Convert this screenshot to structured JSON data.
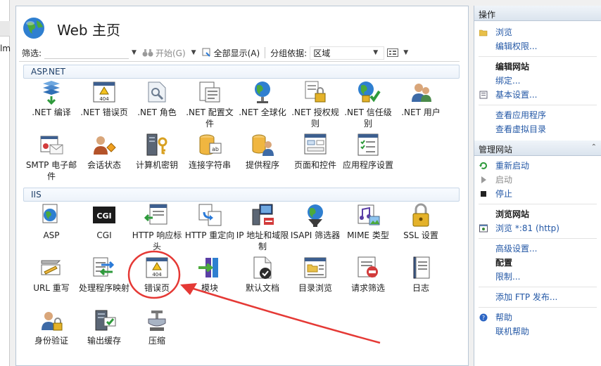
{
  "left_strip": {
    "fragment": "lm"
  },
  "header": {
    "title": "Web 主页"
  },
  "toolbar": {
    "filter_label": "筛选:",
    "filter_value": "",
    "start_label": "开始(G)",
    "show_all_label": "全部显示(A)",
    "group_label": "分组依据:",
    "group_value": "区域"
  },
  "sections": [
    {
      "title": "ASP.NET"
    },
    {
      "title": "IIS"
    }
  ],
  "aspnet_items": [
    {
      "label": ".NET 编译",
      "icon": "net-compile-icon"
    },
    {
      "label": ".NET 错误页",
      "icon": "net-error-page-icon"
    },
    {
      "label": ".NET 角色",
      "icon": "net-roles-icon"
    },
    {
      "label": ".NET 配置文件",
      "icon": "net-profile-icon"
    },
    {
      "label": ".NET 全球化",
      "icon": "net-globalization-icon"
    },
    {
      "label": ".NET 授权规则",
      "icon": "net-authorization-icon"
    },
    {
      "label": ".NET 信任级别",
      "icon": "net-trust-icon"
    },
    {
      "label": ".NET 用户",
      "icon": "net-users-icon"
    },
    {
      "label": "SMTP 电子邮件",
      "icon": "smtp-email-icon"
    },
    {
      "label": "会话状态",
      "icon": "session-state-icon"
    },
    {
      "label": "计算机密钥",
      "icon": "machine-key-icon"
    },
    {
      "label": "连接字符串",
      "icon": "connection-strings-icon"
    },
    {
      "label": "提供程序",
      "icon": "providers-icon"
    },
    {
      "label": "页面和控件",
      "icon": "pages-controls-icon"
    },
    {
      "label": "应用程序设置",
      "icon": "app-settings-icon"
    }
  ],
  "iis_items": [
    {
      "label": "ASP",
      "icon": "asp-icon"
    },
    {
      "label": "CGI",
      "icon": "cgi-icon"
    },
    {
      "label": "HTTP 响应标头",
      "icon": "http-headers-icon"
    },
    {
      "label": "HTTP 重定向",
      "icon": "http-redirect-icon"
    },
    {
      "label": "IP 地址和域限制",
      "icon": "ip-restrictions-icon"
    },
    {
      "label": "ISAPI 筛选器",
      "icon": "isapi-filters-icon"
    },
    {
      "label": "MIME 类型",
      "icon": "mime-types-icon"
    },
    {
      "label": "SSL 设置",
      "icon": "ssl-settings-icon"
    },
    {
      "label": "URL 重写",
      "icon": "url-rewrite-icon"
    },
    {
      "label": "处理程序映射",
      "icon": "handler-mappings-icon"
    },
    {
      "label": "错误页",
      "icon": "error-pages-icon"
    },
    {
      "label": "模块",
      "icon": "modules-icon"
    },
    {
      "label": "默认文档",
      "icon": "default-document-icon"
    },
    {
      "label": "目录浏览",
      "icon": "directory-browsing-icon"
    },
    {
      "label": "请求筛选",
      "icon": "request-filtering-icon"
    },
    {
      "label": "日志",
      "icon": "logging-icon"
    },
    {
      "label": "身份验证",
      "icon": "authentication-icon"
    },
    {
      "label": "输出缓存",
      "icon": "output-caching-icon"
    },
    {
      "label": "压缩",
      "icon": "compression-icon"
    }
  ],
  "actions": {
    "header": "操作",
    "explore": "浏览",
    "edit_permissions": "编辑权限...",
    "edit_site": "编辑网站",
    "bindings": "绑定...",
    "basic_settings": "基本设置...",
    "view_apps": "查看应用程序",
    "view_vdirs": "查看虚拟目录",
    "manage_site": "管理网站",
    "restart": "重新启动",
    "start": "启动",
    "stop": "停止",
    "browse_site": "浏览网站",
    "browse_port": "浏览 *:81 (http)",
    "advanced_settings": "高级设置...",
    "configure": "配置",
    "limits": "限制...",
    "add_ftp": "添加 FTP 发布...",
    "help": "帮助",
    "online_help": "联机帮助"
  },
  "colors": {
    "link": "#2458a6",
    "annotation": "#e53935",
    "section_header": "#1e3f68"
  }
}
